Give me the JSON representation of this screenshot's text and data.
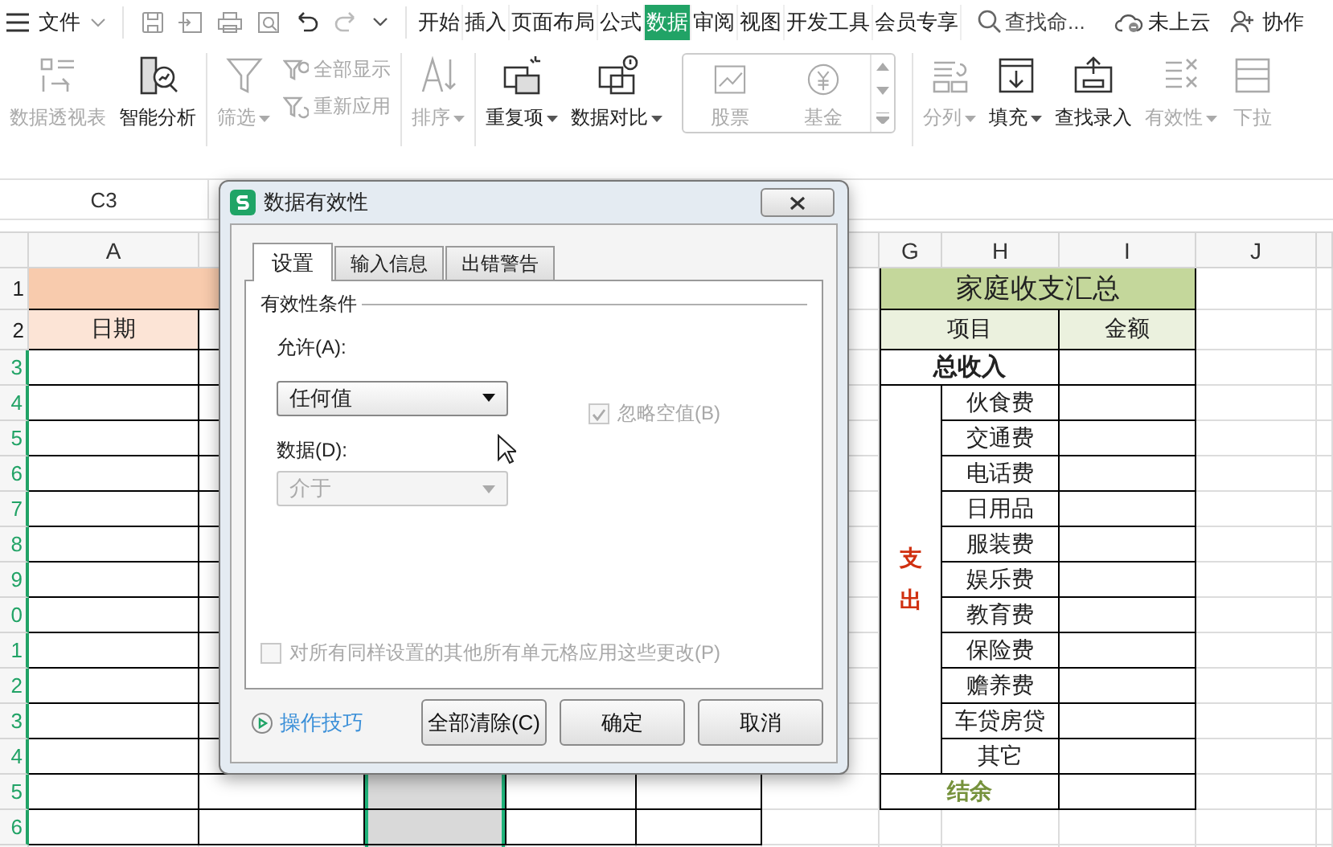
{
  "menu_bar": {
    "file_label": "文件",
    "tabs": [
      {
        "label": "开始",
        "selected": false
      },
      {
        "label": "插入",
        "selected": false
      },
      {
        "label": "页面布局",
        "selected": false
      },
      {
        "label": "公式",
        "selected": false
      },
      {
        "label": "数据",
        "selected": true
      },
      {
        "label": "审阅",
        "selected": false
      },
      {
        "label": "视图",
        "selected": false
      },
      {
        "label": "开发工具",
        "selected": false
      },
      {
        "label": "会员专享",
        "selected": false
      }
    ],
    "search": {
      "placeholder": "查找命..."
    },
    "cloud_status": "未上云",
    "collaborate": "协作"
  },
  "ribbon": {
    "groups": [
      {
        "items": [
          {
            "kind": "large",
            "label": "数据透视表",
            "disabled": true,
            "dropdown": false
          },
          {
            "kind": "large",
            "label": "智能分析",
            "disabled": false,
            "dropdown": false
          }
        ]
      },
      {
        "items": [
          {
            "kind": "large",
            "label": "筛选",
            "disabled": true,
            "dropdown": true
          },
          {
            "kind": "stack",
            "entries": [
              {
                "label": "全部显示",
                "disabled": true
              },
              {
                "label": "重新应用",
                "disabled": true
              }
            ]
          }
        ]
      },
      {
        "items": [
          {
            "kind": "large",
            "label": "排序",
            "disabled": true,
            "dropdown": true
          }
        ]
      },
      {
        "items": [
          {
            "kind": "large",
            "label": "重复项",
            "disabled": false,
            "dropdown": true
          },
          {
            "kind": "large",
            "label": "数据对比",
            "disabled": false,
            "dropdown": true
          },
          {
            "kind": "gallery",
            "entries": [
              {
                "label": "股票",
                "disabled": true
              },
              {
                "label": "基金",
                "disabled": true
              }
            ]
          }
        ]
      },
      {
        "items": [
          {
            "kind": "large",
            "label": "分列",
            "disabled": true,
            "dropdown": true
          },
          {
            "kind": "large",
            "label": "填充",
            "disabled": false,
            "dropdown": true
          },
          {
            "kind": "large",
            "label": "查找录入",
            "disabled": false,
            "dropdown": false
          },
          {
            "kind": "large",
            "label": "有效性",
            "disabled": true,
            "dropdown": true
          },
          {
            "kind": "large",
            "label": "下拉",
            "disabled": true,
            "dropdown": false
          }
        ]
      }
    ]
  },
  "formula_bar": {
    "name_box": "C3"
  },
  "sheet": {
    "columns": [
      {
        "header": "A",
        "selected": false
      },
      {
        "selected": false
      },
      {
        "selected": true
      },
      {
        "selected": false
      },
      {
        "selected": false
      },
      {
        "selected": false
      },
      {
        "header": "G",
        "selected": false
      },
      {
        "header": "H",
        "selected": false
      },
      {
        "header": "I",
        "selected": false
      },
      {
        "header": "J",
        "selected": false
      }
    ],
    "rows": [
      {
        "header": "1",
        "selected": false
      },
      {
        "header": "2",
        "selected": false
      },
      {
        "header": "3",
        "selected": true
      },
      {
        "header": "4",
        "selected": true
      },
      {
        "header": "5",
        "selected": true
      },
      {
        "header": "6",
        "selected": true
      },
      {
        "header": "7",
        "selected": true
      },
      {
        "header": "8",
        "selected": true
      },
      {
        "header": "9",
        "selected": true
      },
      {
        "header": "0",
        "selected": true
      },
      {
        "header": "1",
        "selected": true
      },
      {
        "header": "2",
        "selected": true
      },
      {
        "header": "3",
        "selected": true
      },
      {
        "header": "4",
        "selected": true
      },
      {
        "header": "5",
        "selected": true
      },
      {
        "header": "6",
        "selected": true
      }
    ],
    "left_table": {
      "date_header": "日期"
    },
    "summary": {
      "title": "家庭收支汇总",
      "item_header": "项目",
      "amount_header": "金额",
      "income_label": "总收入",
      "expense_label": "支出",
      "expense_items": [
        "伙食费",
        "交通费",
        "电话费",
        "日用品",
        "服装费",
        "娱乐费",
        "教育费",
        "保险费",
        "赡养费",
        "车贷房贷",
        "其它"
      ],
      "balance_label": "结余"
    }
  },
  "dialog": {
    "title": "数据有效性",
    "tabs": [
      {
        "label": "设置",
        "selected": true
      },
      {
        "label": "输入信息",
        "selected": false
      },
      {
        "label": "出错警告",
        "selected": false
      }
    ],
    "group_title": "有效性条件",
    "allow_label": "允许(A):",
    "allow_value": "任何值",
    "ignore_blank": {
      "label": "忽略空值(B)",
      "checked": true,
      "disabled": true
    },
    "data_label": "数据(D):",
    "data_select": {
      "value": "介于",
      "disabled": true
    },
    "apply_all": {
      "label": "对所有同样设置的其他所有单元格应用这些更改(P)",
      "checked": false,
      "disabled": true
    },
    "tips_link": "操作技巧",
    "buttons": [
      "全部清除(C)",
      "确定",
      "取消"
    ]
  }
}
